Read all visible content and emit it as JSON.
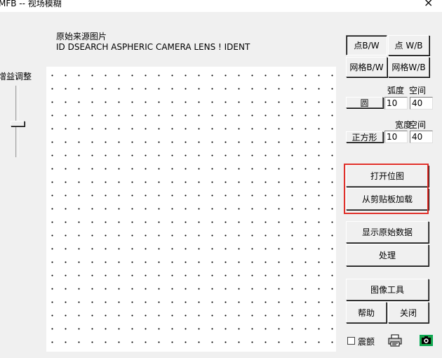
{
  "window": {
    "title": "MFB -- 视场模糊",
    "close_glyph": "×"
  },
  "source_image": {
    "label": "原始来源图片",
    "identity": "ID DSEARCH ASPHERIC CAMERA LENS ! IDENT"
  },
  "gain": {
    "label": "增益调整"
  },
  "pattern_buttons": {
    "dot_bw": "点B/W",
    "dot_wb": "点 W/B",
    "grid_bw": "网格B/W",
    "grid_wb": "网格W/B",
    "selected": "dot_bw"
  },
  "circle": {
    "header_arc": "弧度",
    "header_spacing": "空间",
    "button": "圆",
    "arc_value": "10",
    "spacing_value": "40"
  },
  "square": {
    "header_width": "宽度",
    "header_spacing": "空间",
    "button": "正方形",
    "width_value": "10",
    "spacing_value": "40"
  },
  "actions": {
    "open_bitmap": "打开位图",
    "load_clipboard": "从剪贴板加载",
    "show_raw_data": "显示原始数据",
    "process": "处理",
    "image_tools": "图像工具",
    "help": "帮助",
    "close": "关闭"
  },
  "footer": {
    "shake_label": "震颤",
    "shake_checked": false
  },
  "icons": {
    "printer": "printer-icon",
    "camera": "camera-icon"
  },
  "colors": {
    "highlight": "#e0302a",
    "camera_green": "#1aa34a"
  }
}
